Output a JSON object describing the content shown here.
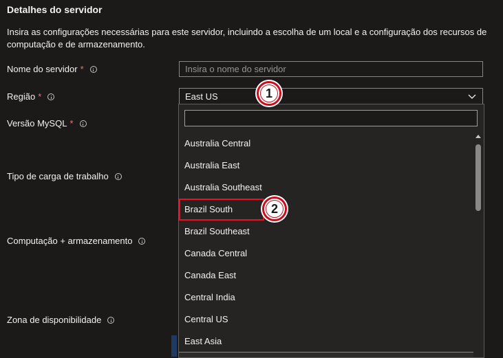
{
  "section": {
    "title": "Detalhes do servidor",
    "description": "Insira as configurações necessárias para este servidor, incluindo a escolha de um local e a configuração dos recursos de computação e de armazenamento."
  },
  "fields": {
    "server_name": {
      "label": "Nome do servidor",
      "required": "*",
      "placeholder": "Insira o nome do servidor"
    },
    "region": {
      "label": "Região",
      "required": "*",
      "value": "East US"
    },
    "mysql_version": {
      "label": "Versão MySQL",
      "required": "*"
    },
    "workload_type": {
      "label": "Tipo de carga de trabalho"
    },
    "compute_storage": {
      "label": "Computação + armazenamento"
    },
    "availability_zone": {
      "label": "Zona de disponibilidade"
    }
  },
  "dropdown": {
    "search_value": "",
    "items": [
      "Australia Central",
      "Australia East",
      "Australia Southeast",
      "Brazil South",
      "Brazil Southeast",
      "Canada Central",
      "Canada East",
      "Central India",
      "Central US",
      "East Asia"
    ]
  },
  "callouts": {
    "step1": "1",
    "step2": "2"
  },
  "colors": {
    "background": "#1b1a19",
    "highlight_box": "#e81123",
    "required": "#f1707b"
  }
}
